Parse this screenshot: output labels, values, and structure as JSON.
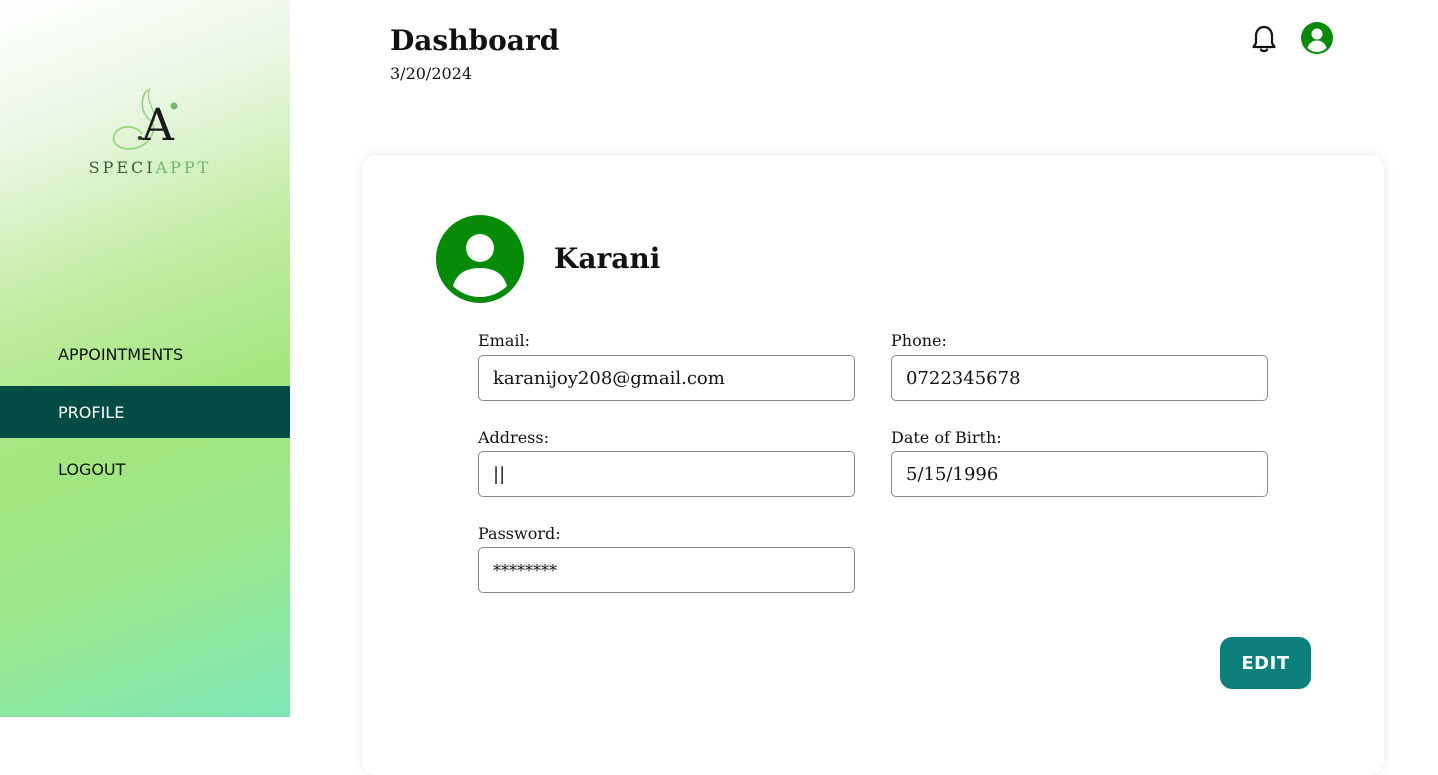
{
  "app": {
    "logo_letter": "A",
    "logo_text_dark": "SPECI",
    "logo_text_accent": "APPT"
  },
  "sidebar": {
    "items": [
      {
        "label": "APPOINTMENTS",
        "active": false
      },
      {
        "label": "PROFILE",
        "active": true
      },
      {
        "label": "LOGOUT",
        "active": false
      }
    ]
  },
  "header": {
    "title": "Dashboard",
    "date": "3/20/2024"
  },
  "profile": {
    "name": "Karani",
    "fields": {
      "email": {
        "label": "Email:",
        "value": "karanijoy208@gmail.com"
      },
      "phone": {
        "label": "Phone:",
        "value": "0722345678"
      },
      "address": {
        "label": "Address:",
        "value": "||"
      },
      "dob": {
        "label": "Date of Birth:",
        "value": "5/15/1996"
      },
      "password": {
        "label": "Password:",
        "value": "********"
      }
    },
    "edit_label": "EDIT"
  },
  "colors": {
    "active_nav": "#024c45",
    "accent_green": "#078a07",
    "button_teal": "#0b7f7b"
  },
  "icons": {
    "notification": "bell-icon",
    "account": "user-circle-icon"
  }
}
